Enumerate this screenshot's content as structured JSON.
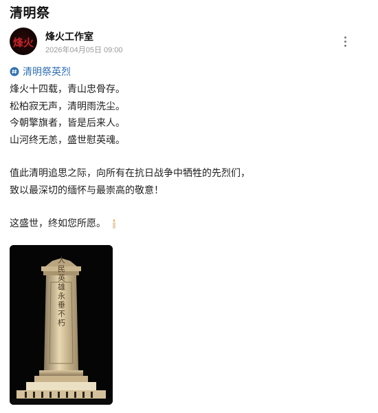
{
  "page": {
    "title": "清明祭"
  },
  "author": {
    "name": "烽火工作室",
    "avatar_text": "烽火",
    "time": "2026年04月05日 09:00"
  },
  "topic": {
    "label": "清明祭英烈",
    "icon": "topic-hash-icon"
  },
  "post": {
    "poem": [
      "烽火十四载，青山忠骨存。",
      "松柏寂无声，清明雨洗尘。",
      "今朝擎旗者，皆是后来人。",
      "山河终无恙，盛世慰英魂。"
    ],
    "tribute": [
      "值此清明追思之际，向所有在抗日战争中牺牲的先烈们，",
      "致以最深切的缅怀与最崇高的敬意！"
    ],
    "closing": "这盛世，终如您所愿。",
    "closing_icon": "candle-icon"
  },
  "image": {
    "subject": "monument-photo",
    "inscription": "人民英雄永垂不朽"
  },
  "colors": {
    "topic_link": "#2f6fb3",
    "meta_gray": "#9a9a9a",
    "photo_bg": "#050505"
  }
}
